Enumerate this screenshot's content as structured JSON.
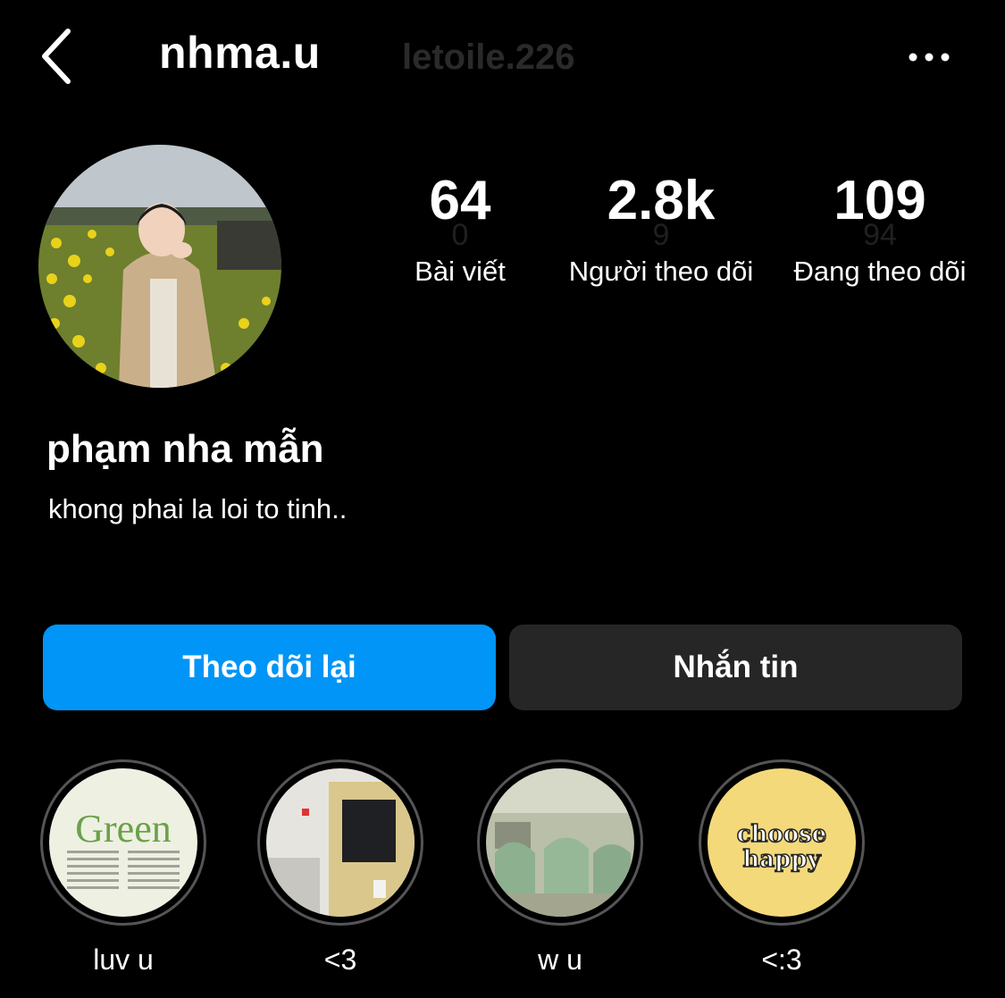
{
  "header": {
    "username": "nhma.u",
    "ghost_username": "letoile.226"
  },
  "stats": [
    {
      "value": "64",
      "label": "Bài viết"
    },
    {
      "value": "2.8k",
      "label": "Người theo dõi"
    },
    {
      "value": "109",
      "label": "Đang theo dõi"
    }
  ],
  "profile": {
    "display_name": "phạm nha mẫn",
    "bio": "khong phai la loi to tinh.."
  },
  "buttons": {
    "follow_back": "Theo dõi lại",
    "message": "Nhắn tin"
  },
  "highlights": [
    {
      "label": "luv u",
      "cover_title": "Green"
    },
    {
      "label": "<3"
    },
    {
      "label": "w u"
    },
    {
      "label": "<:3",
      "cover_line1": "choose",
      "cover_line2": "happy"
    }
  ],
  "colors": {
    "background": "#000000",
    "primary_button": "#0095f6",
    "secondary_button": "#262626"
  },
  "icons": [
    "back-chevron-icon",
    "more-options-icon"
  ]
}
